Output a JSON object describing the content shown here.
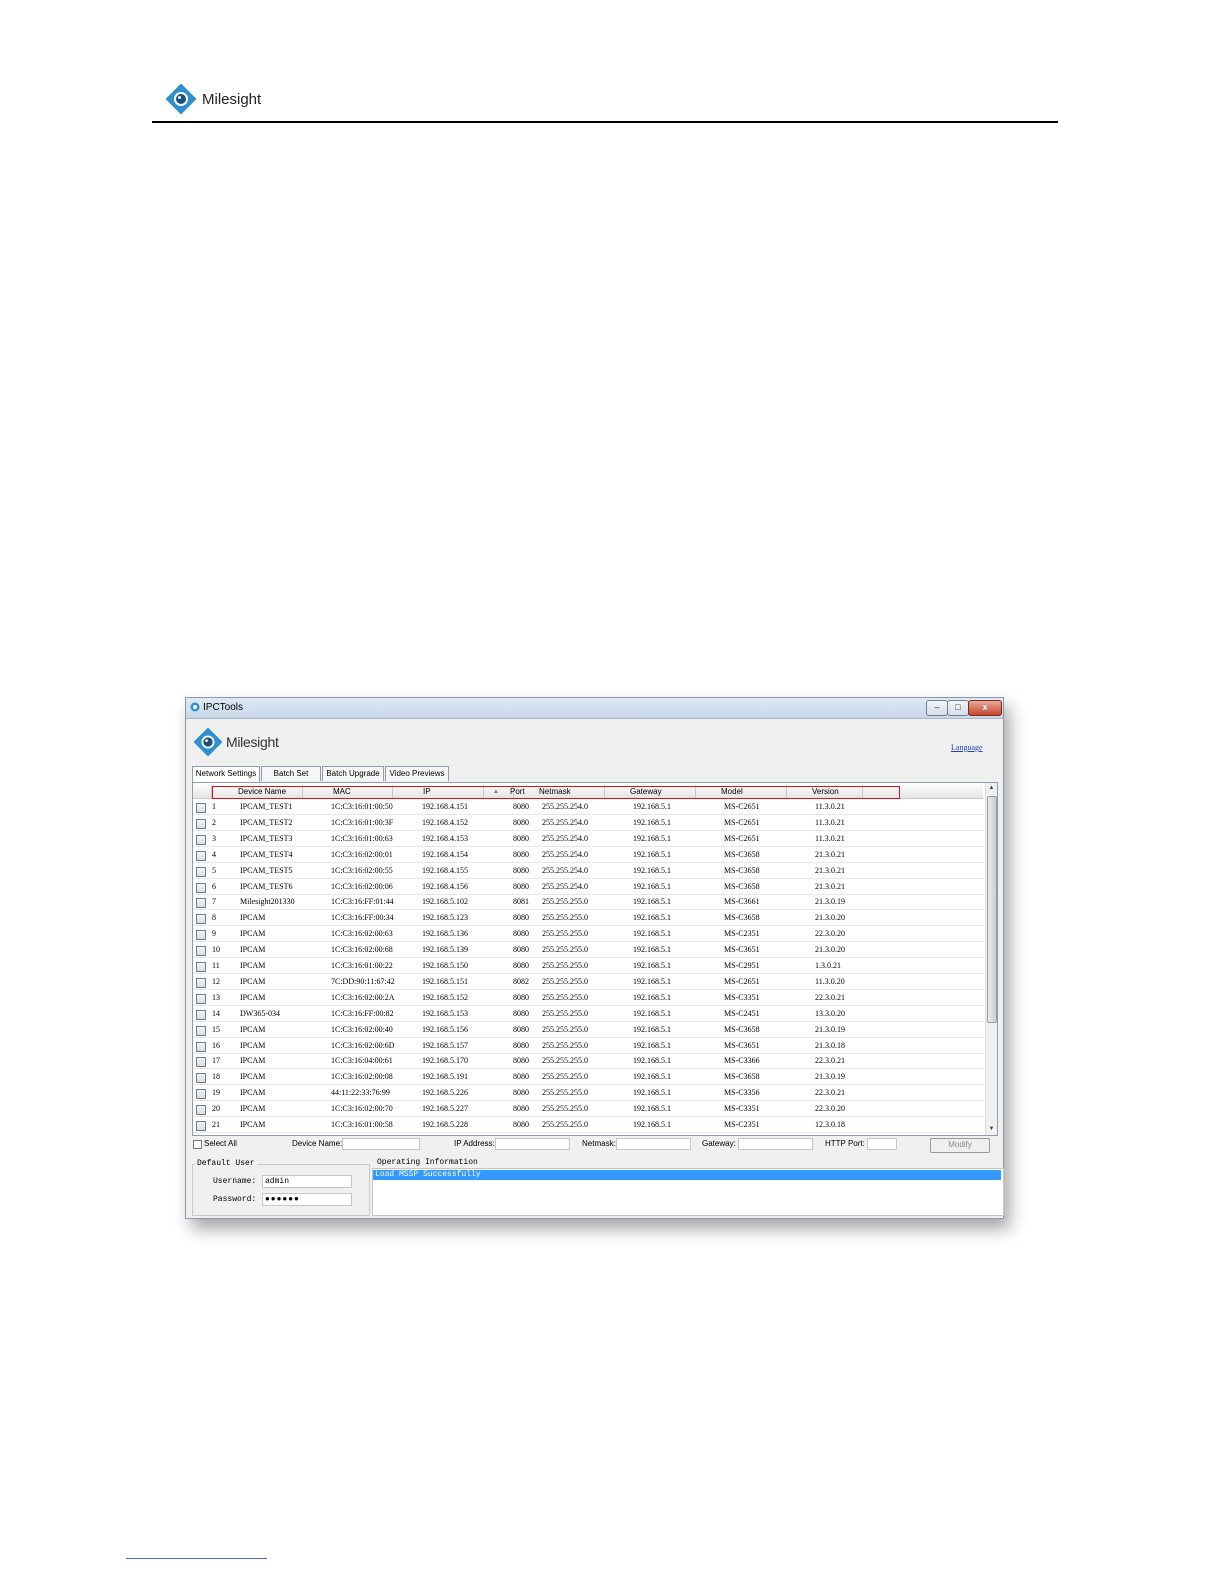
{
  "document": {
    "brand": "Milesight"
  },
  "window": {
    "title": "IPCTools",
    "brand": "Milesight",
    "language_link": "Language",
    "controls": {
      "minimize": "–",
      "maximize": "□",
      "close": "x"
    }
  },
  "tabs": [
    {
      "label": "Network Settings",
      "active": true
    },
    {
      "label": "Batch Set",
      "active": false
    },
    {
      "label": "Batch Upgrade",
      "active": false
    },
    {
      "label": "Video Previews",
      "active": false
    }
  ],
  "table": {
    "columns": [
      "Device Name",
      "MAC",
      "IP",
      "Port",
      "Netmask",
      "Gateway",
      "Model",
      "Version"
    ],
    "rows": [
      [
        "1",
        "IPCAM_TEST1",
        "1C:C3:16:01:00:50",
        "192.168.4.151",
        "8080",
        "255.255.254.0",
        "192.168.5.1",
        "MS-C2651",
        "11.3.0.21"
      ],
      [
        "2",
        "IPCAM_TEST2",
        "1C:C3:16:01:00:3F",
        "192.168.4.152",
        "8080",
        "255.255.254.0",
        "192.168.5.1",
        "MS-C2651",
        "11.3.0.21"
      ],
      [
        "3",
        "IPCAM_TEST3",
        "1C:C3:16:01:00:63",
        "192.168.4.153",
        "8080",
        "255.255.254.0",
        "192.168.5.1",
        "MS-C2651",
        "11.3.0.21"
      ],
      [
        "4",
        "IPCAM_TEST4",
        "1C:C3:16:02:00:01",
        "192.168.4.154",
        "8080",
        "255.255.254.0",
        "192.168.5.1",
        "MS-C3658",
        "21.3.0.21"
      ],
      [
        "5",
        "IPCAM_TEST5",
        "1C:C3:16:02:00:55",
        "192.168.4.155",
        "8080",
        "255.255.254.0",
        "192.168.5.1",
        "MS-C3658",
        "21.3.0.21"
      ],
      [
        "6",
        "IPCAM_TEST6",
        "1C:C3:16:02:00:06",
        "192.168.4.156",
        "8080",
        "255.255.254.0",
        "192.168.5.1",
        "MS-C3658",
        "21.3.0.21"
      ],
      [
        "7",
        "Milesight201330",
        "1C:C3:16:FF:01:44",
        "192.168.5.102",
        "8081",
        "255.255.255.0",
        "192.168.5.1",
        "MS-C3661",
        "21.3.0.19"
      ],
      [
        "8",
        "IPCAM",
        "1C:C3:16:FF:00:34",
        "192.168.5.123",
        "8080",
        "255.255.255.0",
        "192.168.5.1",
        "MS-C3658",
        "21.3.0.20"
      ],
      [
        "9",
        "IPCAM",
        "1C:C3:16:02:00:63",
        "192.168.5.136",
        "8080",
        "255.255.255.0",
        "192.168.5.1",
        "MS-C2351",
        "22.3.0.20"
      ],
      [
        "10",
        "IPCAM",
        "1C:C3:16:02:00:68",
        "192.168.5.139",
        "8080",
        "255.255.255.0",
        "192.168.5.1",
        "MS-C3651",
        "21.3.0.20"
      ],
      [
        "11",
        "IPCAM",
        "1C:C3:16:01:00:22",
        "192.168.5.150",
        "8080",
        "255.255.255.0",
        "192.168.5.1",
        "MS-C2951",
        "1.3.0.21"
      ],
      [
        "12",
        "IPCAM",
        "7C:DD:90:11:67:42",
        "192.168.5.151",
        "8082",
        "255.255.255.0",
        "192.168.5.1",
        "MS-C2651",
        "11.3.0.20"
      ],
      [
        "13",
        "IPCAM",
        "1C:C3:16:02:00:2A",
        "192.168.5.152",
        "8080",
        "255.255.255.0",
        "192.168.5.1",
        "MS-C3351",
        "22.3.0.21"
      ],
      [
        "14",
        "DW365-034",
        "1C:C3:16:FF:00:82",
        "192.168.5.153",
        "8080",
        "255.255.255.0",
        "192.168.5.1",
        "MS-C2451",
        "13.3.0.20"
      ],
      [
        "15",
        "IPCAM",
        "1C:C3:16:02:00:40",
        "192.168.5.156",
        "8080",
        "255.255.255.0",
        "192.168.5.1",
        "MS-C3658",
        "21.3.0.19"
      ],
      [
        "16",
        "IPCAM",
        "1C:C3:16:02:00:6D",
        "192.168.5.157",
        "8080",
        "255.255.255.0",
        "192.168.5.1",
        "MS-C3651",
        "21.3.0.18"
      ],
      [
        "17",
        "IPCAM",
        "1C:C3:16:04:00:61",
        "192.168.5.170",
        "8080",
        "255.255.255.0",
        "192.168.5.1",
        "MS-C3366",
        "22.3.0.21"
      ],
      [
        "18",
        "IPCAM",
        "1C:C3:16:02:00:08",
        "192.168.5.191",
        "8080",
        "255.255.255.0",
        "192.168.5.1",
        "MS-C3658",
        "21.3.0.19"
      ],
      [
        "19",
        "IPCAM",
        "44:11:22:33:76:99",
        "192.168.5.226",
        "8080",
        "255.255.255.0",
        "192.168.5.1",
        "MS-C3356",
        "22.3.0.21"
      ],
      [
        "20",
        "IPCAM",
        "1C:C3:16:02:00:70",
        "192.168.5.227",
        "8080",
        "255.255.255.0",
        "192.168.5.1",
        "MS-C3351",
        "22.3.0.20"
      ],
      [
        "21",
        "IPCAM",
        "1C:C3:16:01:00:58",
        "192.168.5.228",
        "8080",
        "255.255.255.0",
        "192.168.5.1",
        "MS-C2351",
        "12.3.0.18"
      ]
    ]
  },
  "edit_bar": {
    "select_all": "Select All",
    "device_name_label": "Device Name:",
    "ip_label": "IP Address:",
    "netmask_label": "Netmask:",
    "gateway_label": "Gateway:",
    "http_port_label": "HTTP Port:",
    "modify_button": "Modify"
  },
  "default_user": {
    "title": "Default User",
    "username_label": "Username:",
    "username_value": "admin",
    "password_label": "Password:",
    "password_value": "●●●●●●"
  },
  "operating_info": {
    "title": "Operating Information",
    "message": "Load MSSP Successfully"
  },
  "colors": {
    "highlight_box": "#d0161c",
    "selection": "#3399ff",
    "link": "#1f3fbf"
  }
}
